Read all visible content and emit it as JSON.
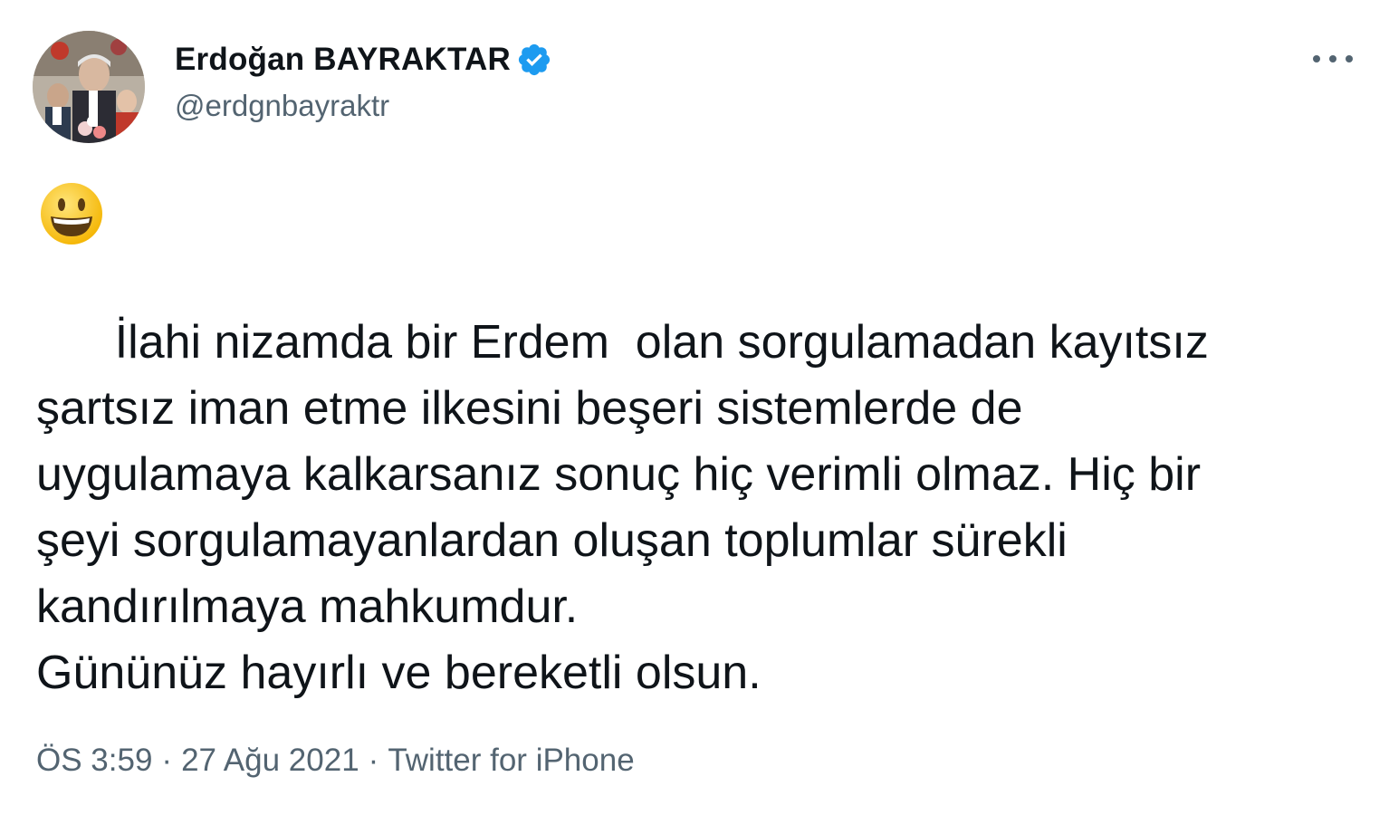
{
  "author": {
    "display_name": "Erdoğan BAYRAKTAR",
    "handle": "@erdgnbayraktr",
    "verified": true,
    "verified_color": "#1d9bf0"
  },
  "emoji": "grinning-face",
  "tweet": {
    "text": "      İlahi nizamda bir Erdem  olan sorgulamadan kayıtsız\nşartsız iman etme ilkesini beşeri sistemlerde de\nuygulamaya kalkarsanız sonuç hiç verimli olmaz. Hiç bir\nşeyi sorgulamayanlardan oluşan toplumlar sürekli\nkandırılmaya mahkumdur.\nGününüz hayırlı ve bereketli olsun."
  },
  "meta": {
    "time": "ÖS 3:59",
    "separator": "·",
    "date": "27 Ağu 2021",
    "source": "Twitter for iPhone"
  },
  "icons": {
    "more": "more-horizontal-icon",
    "verified": "verified-badge-icon"
  }
}
